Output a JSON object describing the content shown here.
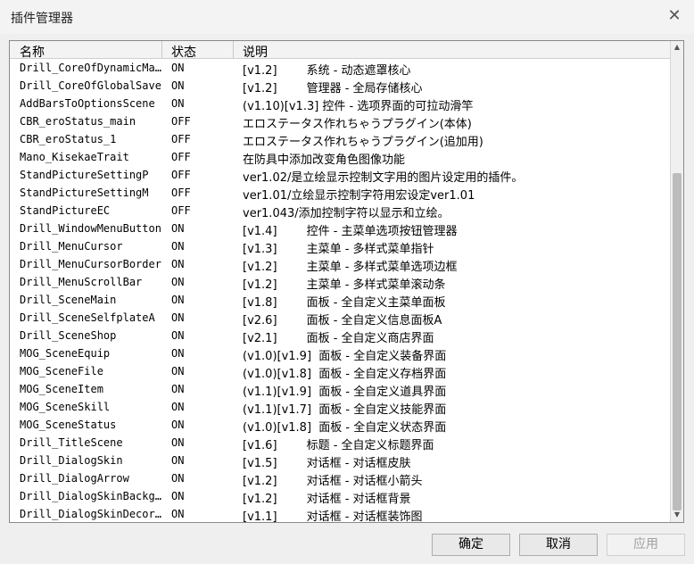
{
  "window": {
    "title": "插件管理器",
    "close_icon": "close-icon"
  },
  "columns": {
    "name": "名称",
    "status": "状态",
    "description": "说明"
  },
  "rows": [
    {
      "name": "Drill_CoreOfDynamicMask",
      "status": "ON",
      "desc": "[v1.2]        系统 - 动态遮罩核心"
    },
    {
      "name": "Drill_CoreOfGlobalSave",
      "status": "ON",
      "desc": "[v1.2]        管理器 - 全局存储核心"
    },
    {
      "name": "AddBarsToOptionsScene",
      "status": "ON",
      "desc": "(v1.10)[v1.3] 控件 - 选项界面的可拉动滑竿"
    },
    {
      "name": "CBR_eroStatus_main",
      "status": "OFF",
      "desc": "エロステータス作れちゃうプラグイン(本体)"
    },
    {
      "name": "CBR_eroStatus_1",
      "status": "OFF",
      "desc": "エロステータス作れちゃうプラグイン(追加用)"
    },
    {
      "name": "Mano_KisekaeTrait",
      "status": "OFF",
      "desc": "在防具中添加改变角色图像功能"
    },
    {
      "name": "StandPictureSettingP",
      "status": "OFF",
      "desc": "ver1.02/是立绘显示控制文字用的图片设定用的插件。"
    },
    {
      "name": "StandPictureSettingM",
      "status": "OFF",
      "desc": "ver1.01/立绘显示控制字符用宏设定ver1.01"
    },
    {
      "name": "StandPictureEC",
      "status": "OFF",
      "desc": "ver1.043/添加控制字符以显示和立绘。"
    },
    {
      "name": "Drill_WindowMenuButton",
      "status": "ON",
      "desc": "[v1.4]        控件 - 主菜单选项按钮管理器"
    },
    {
      "name": "Drill_MenuCursor",
      "status": "ON",
      "desc": "[v1.3]        主菜单 - 多样式菜单指针"
    },
    {
      "name": "Drill_MenuCursorBorder",
      "status": "ON",
      "desc": "[v1.2]        主菜单 - 多样式菜单选项边框"
    },
    {
      "name": "Drill_MenuScrollBar",
      "status": "ON",
      "desc": "[v1.2]        主菜单 - 多样式菜单滚动条"
    },
    {
      "name": "Drill_SceneMain",
      "status": "ON",
      "desc": "[v1.8]        面板 - 全自定义主菜单面板"
    },
    {
      "name": "Drill_SceneSelfplateA",
      "status": "ON",
      "desc": "[v2.6]        面板 - 全自定义信息面板A"
    },
    {
      "name": "Drill_SceneShop",
      "status": "ON",
      "desc": "[v2.1]        面板 - 全自定义商店界面"
    },
    {
      "name": "MOG_SceneEquip",
      "status": "ON",
      "desc": "(v1.0)[v1.9]  面板 - 全自定义装备界面"
    },
    {
      "name": "MOG_SceneFile",
      "status": "ON",
      "desc": "(v1.0)[v1.8]  面板 - 全自定义存档界面"
    },
    {
      "name": "MOG_SceneItem",
      "status": "ON",
      "desc": "(v1.1)[v1.9]  面板 - 全自定义道具界面"
    },
    {
      "name": "MOG_SceneSkill",
      "status": "ON",
      "desc": "(v1.1)[v1.7]  面板 - 全自定义技能界面"
    },
    {
      "name": "MOG_SceneStatus",
      "status": "ON",
      "desc": "(v1.0)[v1.8]  面板 - 全自定义状态界面"
    },
    {
      "name": "Drill_TitleScene",
      "status": "ON",
      "desc": "[v1.6]        标题 - 全自定义标题界面"
    },
    {
      "name": "Drill_DialogSkin",
      "status": "ON",
      "desc": "[v1.5]        对话框 - 对话框皮肤"
    },
    {
      "name": "Drill_DialogArrow",
      "status": "ON",
      "desc": "[v1.2]        对话框 - 对话框小箭头"
    },
    {
      "name": "Drill_DialogSkinBackground",
      "status": "ON",
      "desc": "[v1.2]        对话框 - 对话框背景"
    },
    {
      "name": "Drill_DialogSkinDecoration",
      "status": "ON",
      "desc": "[v1.1]        对话框 - 对话框装饰图"
    }
  ],
  "scrollbar": {
    "up_icon": "arrow-up-icon",
    "down_icon": "arrow-down-icon"
  },
  "buttons": {
    "ok": "确定",
    "cancel": "取消",
    "apply": "应用"
  }
}
